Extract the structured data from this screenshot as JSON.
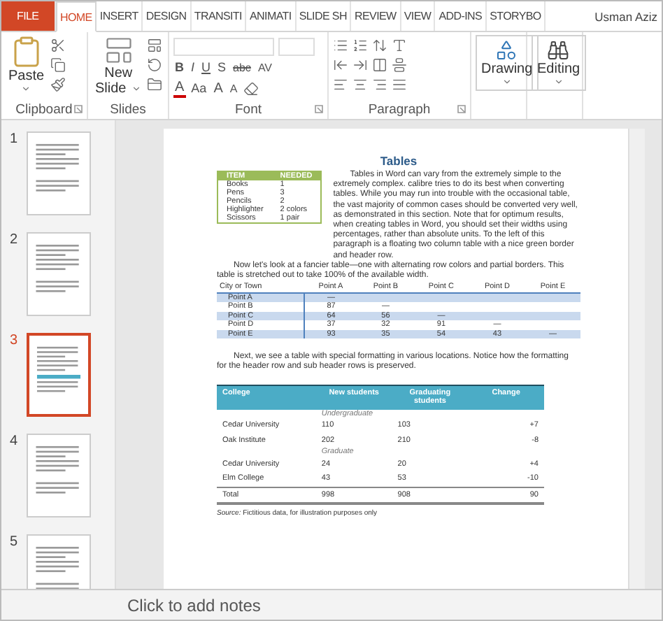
{
  "tabs": [
    {
      "label": "FILE",
      "kind": "file",
      "selected": false
    },
    {
      "label": "HOME",
      "kind": "tab",
      "selected": true
    },
    {
      "label": "INSERT",
      "kind": "tab",
      "selected": false
    },
    {
      "label": "DESIGN",
      "kind": "tab",
      "selected": false
    },
    {
      "label": "TRANSITI",
      "kind": "tab",
      "selected": false
    },
    {
      "label": "ANIMATI",
      "kind": "tab",
      "selected": false
    },
    {
      "label": "SLIDE SH",
      "kind": "tab",
      "selected": false
    },
    {
      "label": "REVIEW",
      "kind": "tab",
      "selected": false
    },
    {
      "label": "VIEW",
      "kind": "tab",
      "selected": false
    },
    {
      "label": "ADD-INS",
      "kind": "tab",
      "selected": false
    },
    {
      "label": "STORYBO",
      "kind": "tab",
      "selected": false
    }
  ],
  "user": "Usman Aziz",
  "ribbon": {
    "clipboard": {
      "paste": "Paste",
      "label": "Clipboard"
    },
    "slides": {
      "new_slide_top": "New",
      "new_slide_bottom": "Slide",
      "label": "Slides"
    },
    "font": {
      "format_buttons": [
        {
          "label": "B",
          "kind": "bold"
        },
        {
          "label": "I",
          "kind": "italic"
        },
        {
          "label": "U",
          "kind": "underline"
        },
        {
          "label": "S",
          "kind": "shadow"
        },
        {
          "label": "abc",
          "kind": "strike"
        },
        {
          "label": "AV",
          "kind": "spacing"
        }
      ],
      "size_buttons": [
        {
          "label": "A",
          "kind": "color"
        },
        {
          "label": "Aa",
          "kind": "case"
        },
        {
          "label": "A",
          "kind": "grow"
        },
        {
          "label": "A",
          "kind": "shrink"
        }
      ],
      "label": "Font"
    },
    "paragraph": {
      "label": "Paragraph"
    },
    "drawing": {
      "label": "Drawing"
    },
    "editing": {
      "label": "Editing"
    }
  },
  "thumbnails": [
    {
      "number": "1",
      "selected": false
    },
    {
      "number": "2",
      "selected": false
    },
    {
      "number": "3",
      "selected": true
    },
    {
      "number": "4",
      "selected": false
    },
    {
      "number": "5",
      "selected": false
    }
  ],
  "slide": {
    "title": "Tables",
    "item_table": {
      "columns": [
        "ITEM",
        "NEEDED"
      ],
      "rows": [
        [
          "Books",
          "1"
        ],
        [
          "Pens",
          "3"
        ],
        [
          "Pencils",
          "2"
        ],
        [
          "Highlighter",
          "2 colors"
        ],
        [
          "Scissors",
          "1 pair"
        ]
      ]
    },
    "paragraphs": [
      "Tables in Word can vary from the extremely simple to the extremely complex. calibre tries to do its best when converting tables. While you may run into trouble with the occasional table, the vast majority of common cases should be converted very well, as demonstrated in this section. Note that for optimum results, when creating tables in Word, you should set their widths using percentages, rather than absolute units.  To the left of this paragraph is a floating two column table with a nice green border and header row.",
      "Now let's look at a fancier table—one with alternating row colors and partial borders. This table is stretched out to take 100% of the available width."
    ],
    "distance_table": {
      "columns": [
        "City or Town",
        "Point A",
        "Point B",
        "Point C",
        "Point D",
        "Point E"
      ],
      "rows": [
        [
          "Point A",
          "—"
        ],
        [
          "Point B",
          "87",
          "—"
        ],
        [
          "Point C",
          "64",
          "56",
          "—"
        ],
        [
          "Point D",
          "37",
          "32",
          "91",
          "—"
        ],
        [
          "Point E",
          "93",
          "35",
          "54",
          "43",
          "—"
        ]
      ]
    },
    "paragraph_3": "Next, we see a table with special formatting in various locations. Notice how the formatting for the header row and sub header rows is preserved.",
    "college_table": {
      "columns": [
        "College",
        "New students",
        "Graduating students",
        "Change"
      ],
      "sections": [
        {
          "label": "Undergraduate",
          "rows": [
            [
              "Cedar University",
              "110",
              "103",
              "+7"
            ],
            [
              "Oak Institute",
              "202",
              "210",
              "-8"
            ]
          ]
        },
        {
          "label": "Graduate",
          "rows": [
            [
              "Cedar University",
              "24",
              "20",
              "+4"
            ],
            [
              "Elm College",
              "43",
              "53",
              "-10"
            ]
          ]
        }
      ],
      "total": [
        "Total",
        "998",
        "908",
        "90"
      ]
    },
    "source": "*Source:* Fictitious data, for illustration purposes only"
  },
  "notes_placeholder": "Click to add notes"
}
